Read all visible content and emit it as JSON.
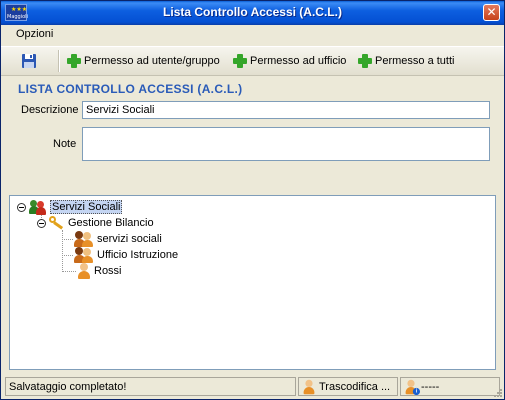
{
  "window": {
    "title": "Lista Controllo Accessi (A.C.L.)",
    "app_icon_label": "Maggioli",
    "close_glyph": "✕"
  },
  "menu": {
    "items": [
      {
        "label": "Opzioni"
      }
    ]
  },
  "toolbar": {
    "save_icon": "floppy-disk-icon",
    "buttons": [
      {
        "label": "Permesso ad utente/gruppo",
        "icon": "add-icon"
      },
      {
        "label": "Permesso ad ufficio",
        "icon": "add-icon"
      },
      {
        "label": "Permesso a tutti",
        "icon": "add-icon"
      }
    ]
  },
  "form": {
    "section_title": "LISTA CONTROLLO ACCESSI (A.C.L.)",
    "descrizione_label": "Descrizione",
    "descrizione_value": "Servizi Sociali",
    "note_label": "Note",
    "note_value": ""
  },
  "tree": {
    "root": {
      "label": "Servizi Sociali",
      "icon": "group-icon",
      "expanded": true,
      "selected": true
    },
    "nodes": [
      {
        "label": "Gestione Bilancio",
        "icon": "key-icon",
        "expanded": true,
        "level": 1
      },
      {
        "label": "servizi sociali",
        "icon": "users-icon",
        "level": 2
      },
      {
        "label": "Ufficio Istruzione",
        "icon": "users-icon",
        "level": 2
      },
      {
        "label": "Rossi",
        "icon": "user-icon",
        "level": 2
      }
    ]
  },
  "statusbar": {
    "message": "Salvataggio completato!",
    "user": "Trascodifica ...",
    "extra": "-----"
  },
  "colors": {
    "section_title": "#2a5bb8",
    "titlebar": "#0450d3",
    "add_icon": "#35a62a"
  }
}
